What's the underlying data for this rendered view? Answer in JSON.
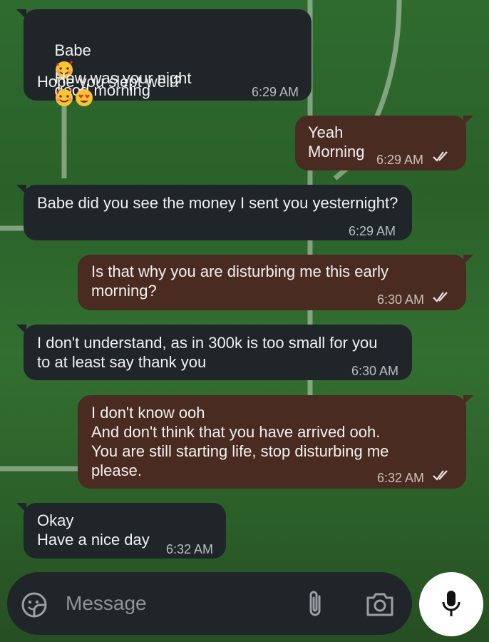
{
  "messages": [
    {
      "direction": "incoming",
      "lines": [
        "Babe",
        "good morning",
        "How was your night",
        "Hope you slept well?"
      ],
      "time": "6:29 AM"
    },
    {
      "direction": "outgoing",
      "lines": [
        "Yeah",
        "Morning"
      ],
      "time": "6:29 AM",
      "status": "read"
    },
    {
      "direction": "incoming",
      "lines": [
        "Babe did you see the money I sent you yesternight?"
      ],
      "time": "6:29 AM"
    },
    {
      "direction": "outgoing",
      "lines": [
        "Is that why you are disturbing me this early",
        "morning?"
      ],
      "time": "6:30 AM",
      "status": "read"
    },
    {
      "direction": "incoming",
      "lines": [
        "I don't understand, as in 300k is too small for you",
        "to at least say thank you"
      ],
      "time": "6:30 AM"
    },
    {
      "direction": "outgoing",
      "lines": [
        "I don't know ooh",
        "And don't think that you have arrived ooh.",
        "You are still starting life, stop disturbing me",
        "please."
      ],
      "time": "6:32 AM",
      "status": "read"
    },
    {
      "direction": "incoming",
      "lines": [
        "Okay",
        "Have a nice day"
      ],
      "time": "6:32 AM"
    }
  ],
  "composer": {
    "placeholder": "Message"
  },
  "icons": {
    "sticker": "sticker-icon",
    "attach": "paperclip-icon",
    "camera": "camera-icon",
    "mic": "microphone-icon",
    "read": "double-check-icon",
    "emoji_love": "smiling-face-with-hearts-emoji",
    "emoji_heart_eyes": "heart-eyes-emoji"
  },
  "colors": {
    "incoming": "#1f2529",
    "outgoing": "#4a2b21",
    "pitch": "#2f6b2f"
  }
}
